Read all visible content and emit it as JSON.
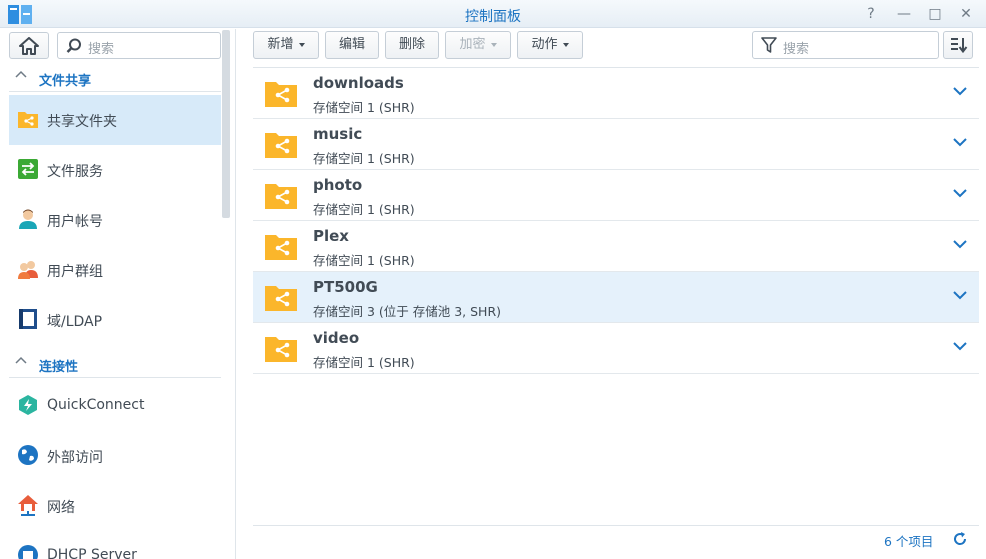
{
  "window": {
    "title": "控制面板",
    "buttons": {
      "help": "?",
      "minimize": "—",
      "maximize": "□",
      "close": "✕"
    }
  },
  "sidebar": {
    "search_placeholder": "搜索",
    "sections": [
      {
        "label": "文件共享",
        "items": [
          "共享文件夹",
          "文件服务",
          "用户帐号",
          "用户群组",
          "域/LDAP"
        ]
      },
      {
        "label": "连接性",
        "items": [
          "QuickConnect",
          "外部访问",
          "网络",
          "DHCP Server"
        ]
      }
    ],
    "active_item": "共享文件夹"
  },
  "toolbar": {
    "create": "新增",
    "edit": "编辑",
    "delete": "删除",
    "encrypt": "加密",
    "action": "动作",
    "filter_placeholder": "搜索"
  },
  "folders": [
    {
      "name": "downloads",
      "desc": "存储空间 1 (SHR)"
    },
    {
      "name": "music",
      "desc": "存储空间 1 (SHR)"
    },
    {
      "name": "photo",
      "desc": "存储空间 1 (SHR)"
    },
    {
      "name": "Plex",
      "desc": "存储空间 1 (SHR)"
    },
    {
      "name": "PT500G",
      "desc": "存储空间 3 (位于 存储池 3, SHR)",
      "selected": true
    },
    {
      "name": "video",
      "desc": "存储空间 1 (SHR)"
    }
  ],
  "footer": {
    "count": "6 个项目"
  },
  "colors": {
    "accent": "#1d74c2",
    "folder": "#fbb62b",
    "selected": "#e5f1fb",
    "active_nav": "#d7eaf9"
  }
}
